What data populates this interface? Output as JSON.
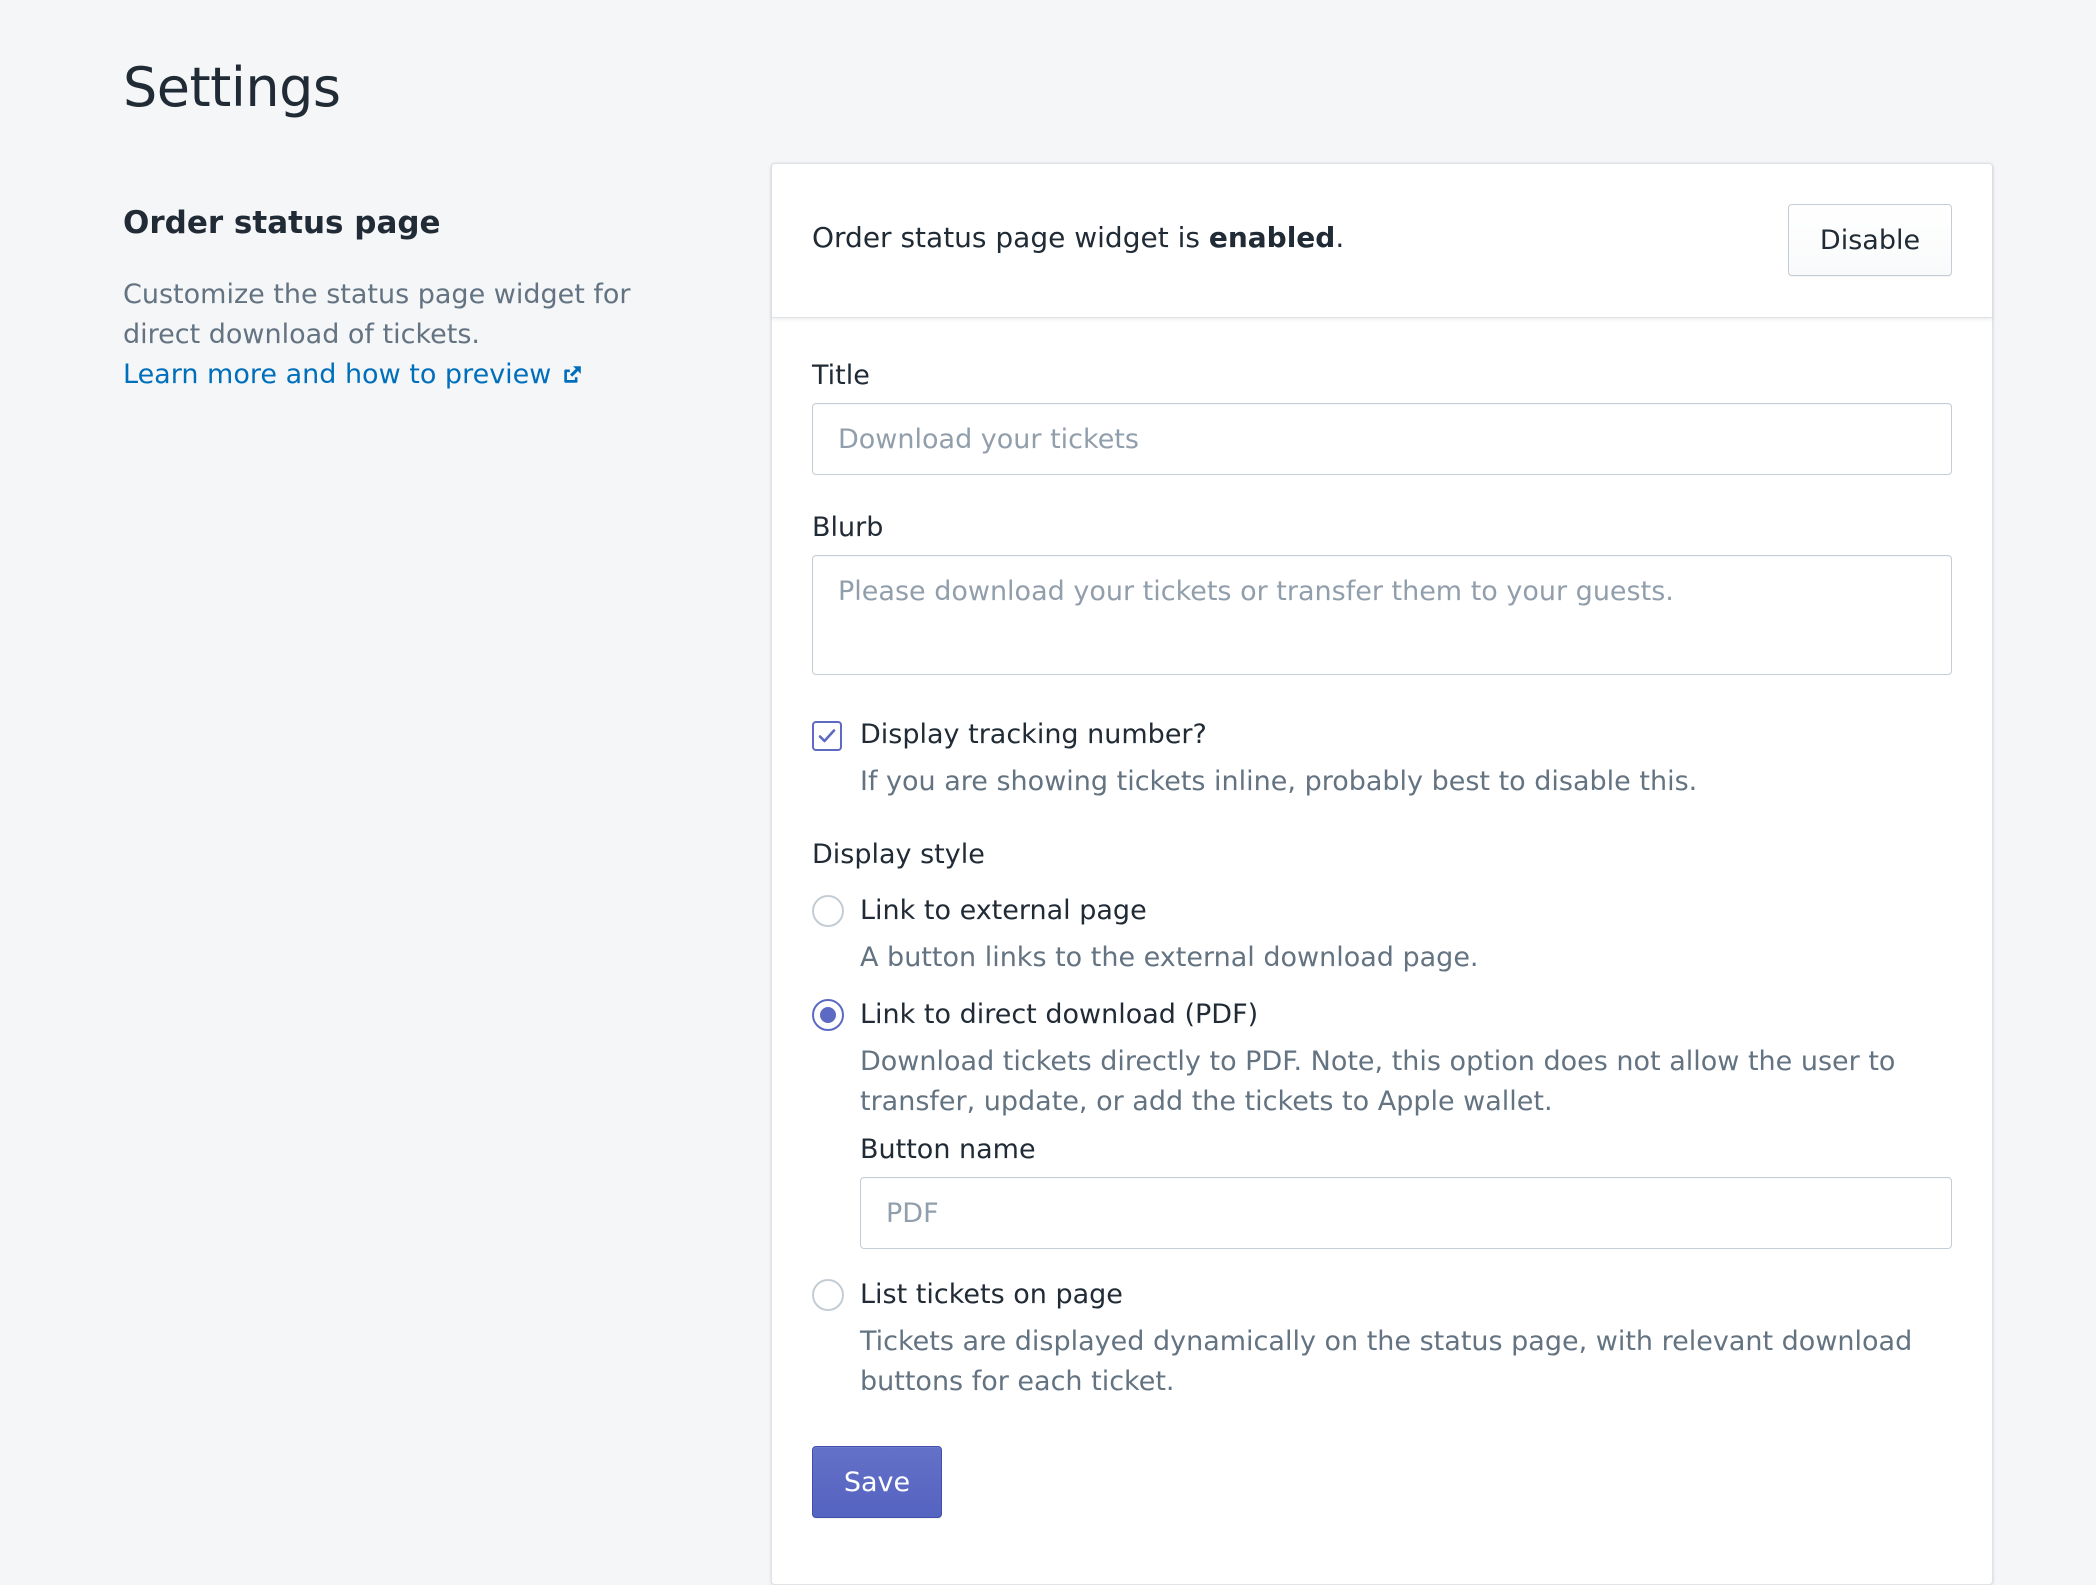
{
  "page": {
    "title": "Settings"
  },
  "section": {
    "heading": "Order status page",
    "description": "Customize the status page widget for direct download of tickets.",
    "link_label": "Learn more and how to preview",
    "link_icon": "external-link-icon"
  },
  "status": {
    "prefix": "Order status page widget is ",
    "state": "enabled",
    "suffix": ".",
    "disable_label": "Disable"
  },
  "form": {
    "title_label": "Title",
    "title_value": "",
    "title_placeholder": "Download your tickets",
    "blurb_label": "Blurb",
    "blurb_value": "",
    "blurb_placeholder": "Please download your tickets or transfer them to your guests.",
    "tracking": {
      "label": "Display tracking number?",
      "checked": true,
      "help": "If you are showing tickets inline, probably best to disable this."
    },
    "display_style": {
      "label": "Display style",
      "selected": "direct_download",
      "options": [
        {
          "id": "external_page",
          "label": "Link to external page",
          "help": "A button links to the external download page."
        },
        {
          "id": "direct_download",
          "label": "Link to direct download (PDF)",
          "help": "Download tickets directly to PDF. Note, this option does not allow the user to transfer, update, or add the tickets to Apple wallet."
        },
        {
          "id": "list_tickets",
          "label": "List tickets on page",
          "help": "Tickets are displayed dynamically on the status page, with relevant download buttons for each ticket."
        }
      ]
    },
    "button_name": {
      "label": "Button name",
      "value": "",
      "placeholder": "PDF"
    },
    "save_label": "Save"
  },
  "colors": {
    "accent": "#5c6ac4",
    "link": "#006fbb",
    "background": "#f5f6f8",
    "muted_text": "#637381"
  }
}
